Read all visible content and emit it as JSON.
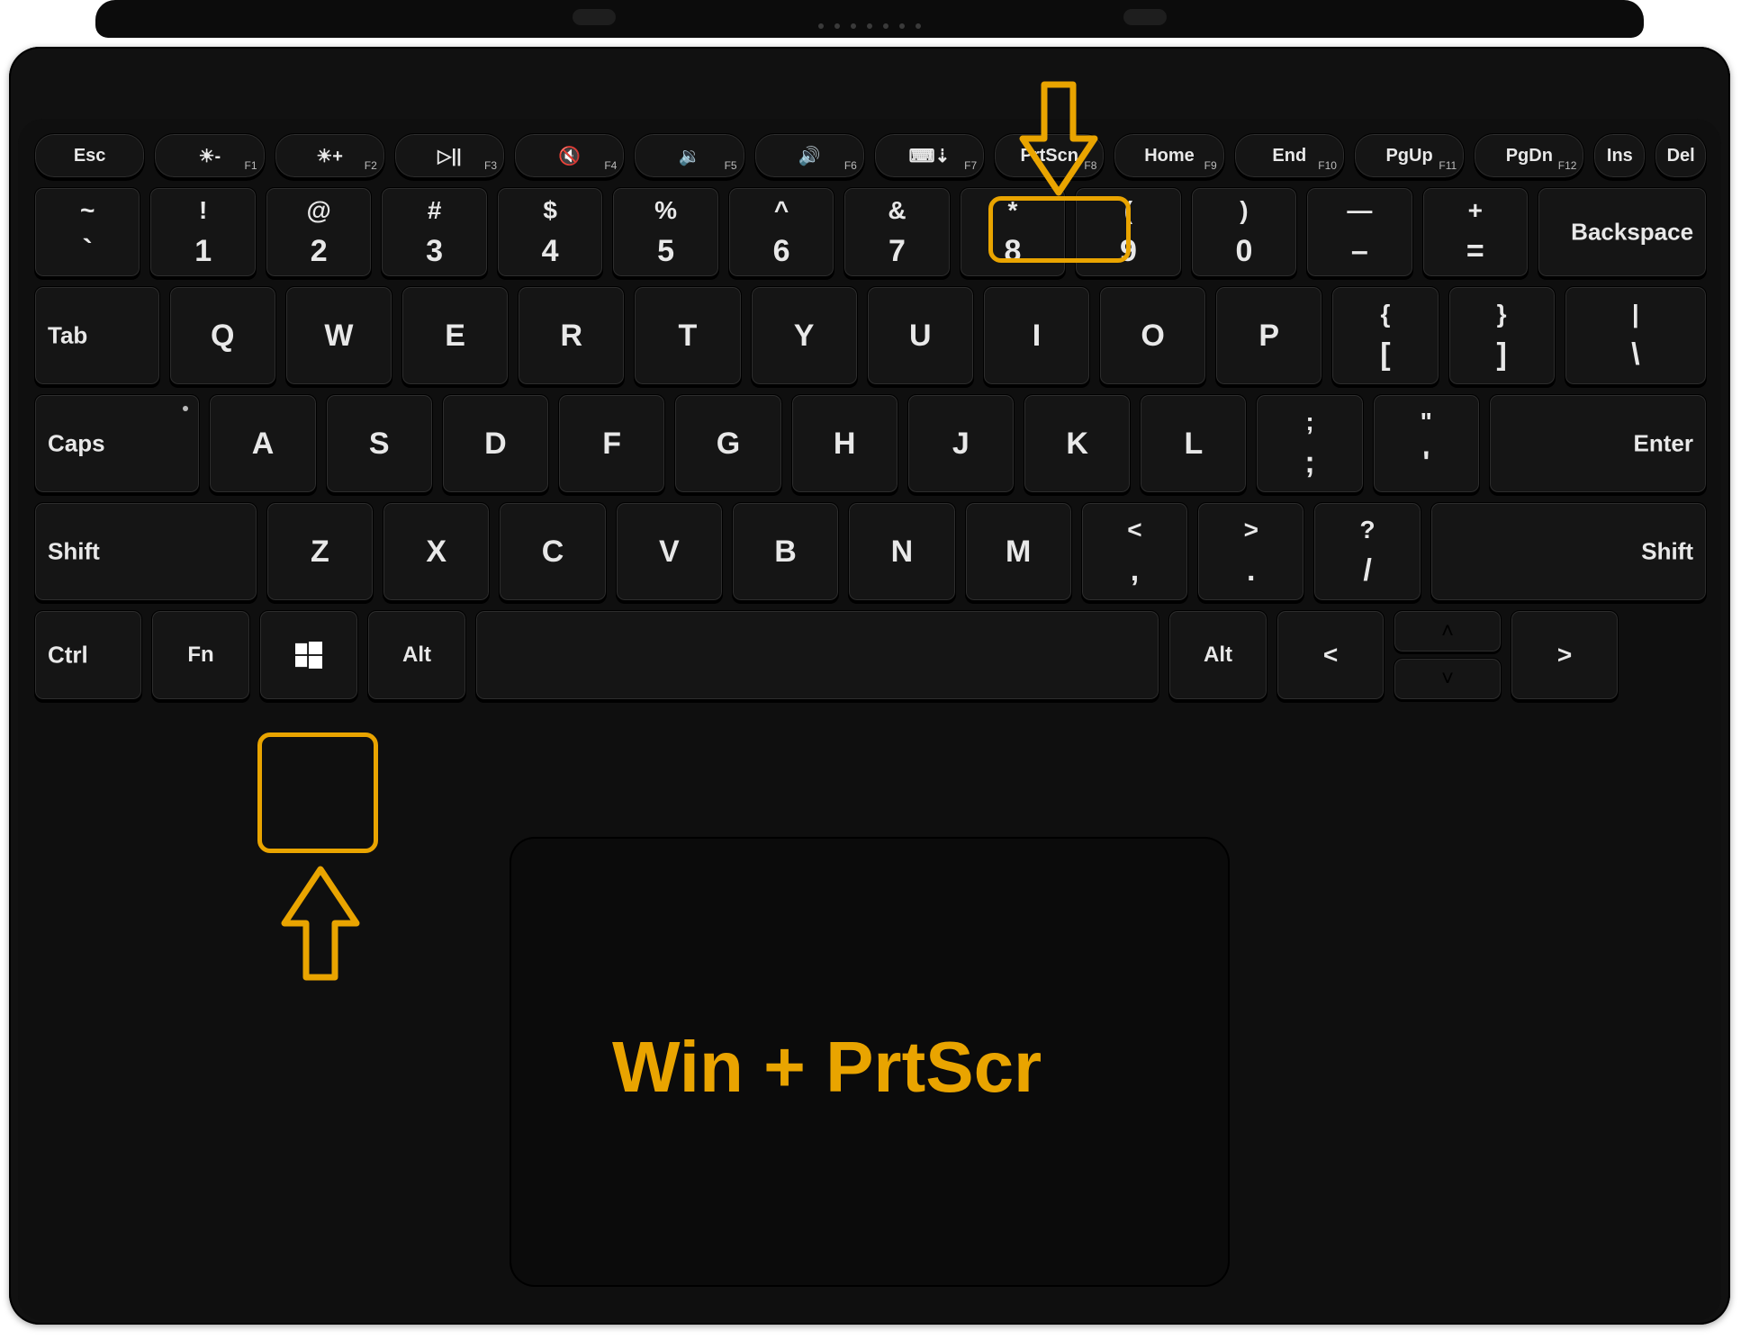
{
  "caption": "Win + PrtScr",
  "highlight_color": "#e9a400",
  "rows": {
    "fn": [
      {
        "label": "Esc",
        "sub": "",
        "name": "key-esc"
      },
      {
        "icon": "☀",
        "mod": "-",
        "sub": "F1",
        "name": "key-brightness-down"
      },
      {
        "icon": "☀",
        "mod": "+",
        "sub": "F2",
        "name": "key-brightness-up"
      },
      {
        "icon": "▷||",
        "sub": "F3",
        "name": "key-play-pause"
      },
      {
        "icon": "🔇",
        "sub": "F4",
        "name": "key-mute"
      },
      {
        "icon": "🔉",
        "sub": "F5",
        "name": "key-vol-down"
      },
      {
        "icon": "🔊",
        "sub": "F6",
        "name": "key-vol-up"
      },
      {
        "icon": "⌨⇣",
        "sub": "F7",
        "name": "key-kbd-backlight"
      },
      {
        "label": "PrtScn",
        "sub": "F8",
        "name": "key-prtscn"
      },
      {
        "label": "Home",
        "sub": "F9",
        "name": "key-home"
      },
      {
        "label": "End",
        "sub": "F10",
        "name": "key-end"
      },
      {
        "label": "PgUp",
        "sub": "F11",
        "name": "key-pgup"
      },
      {
        "label": "PgDn",
        "sub": "F12",
        "name": "key-pgdn"
      },
      {
        "label": "Ins",
        "sub": "",
        "name": "key-ins",
        "narrow": true
      },
      {
        "label": "Del",
        "sub": "",
        "name": "key-del",
        "narrow": true
      }
    ],
    "num": [
      {
        "top": "~",
        "bot": "`",
        "name": "key-backtick"
      },
      {
        "top": "!",
        "bot": "1",
        "name": "key-1"
      },
      {
        "top": "@",
        "bot": "2",
        "name": "key-2"
      },
      {
        "top": "#",
        "bot": "3",
        "name": "key-3"
      },
      {
        "top": "$",
        "bot": "4",
        "name": "key-4"
      },
      {
        "top": "%",
        "bot": "5",
        "name": "key-5"
      },
      {
        "top": "^",
        "bot": "6",
        "name": "key-6"
      },
      {
        "top": "&",
        "bot": "7",
        "name": "key-7"
      },
      {
        "top": "*",
        "bot": "8",
        "name": "key-8"
      },
      {
        "top": "(",
        "bot": "9",
        "name": "key-9"
      },
      {
        "top": ")",
        "bot": "0",
        "name": "key-0"
      },
      {
        "top": "—",
        "bot": "–",
        "name": "key-minus"
      },
      {
        "top": "+",
        "bot": "=",
        "name": "key-equals"
      },
      {
        "label": "Backspace",
        "wide": true,
        "name": "key-backspace"
      }
    ],
    "qw": [
      {
        "label": "Tab",
        "wideL": true,
        "name": "key-tab"
      },
      {
        "label": "Q",
        "name": "key-q"
      },
      {
        "label": "W",
        "name": "key-w"
      },
      {
        "label": "E",
        "name": "key-e"
      },
      {
        "label": "R",
        "name": "key-r"
      },
      {
        "label": "T",
        "name": "key-t"
      },
      {
        "label": "Y",
        "name": "key-y"
      },
      {
        "label": "U",
        "name": "key-u"
      },
      {
        "label": "I",
        "name": "key-i"
      },
      {
        "label": "O",
        "name": "key-o"
      },
      {
        "label": "P",
        "name": "key-p"
      },
      {
        "top": "{",
        "bot": "[",
        "name": "key-lbracket"
      },
      {
        "top": "}",
        "bot": "]",
        "name": "key-rbracket"
      },
      {
        "top": "|",
        "bot": "\\",
        "name": "key-backslash",
        "wideR": true
      }
    ],
    "as": [
      {
        "label": "Caps",
        "wideL": true,
        "name": "key-caps",
        "caps": true
      },
      {
        "label": "A",
        "name": "key-a"
      },
      {
        "label": "S",
        "name": "key-s"
      },
      {
        "label": "D",
        "name": "key-d"
      },
      {
        "label": "F",
        "name": "key-f"
      },
      {
        "label": "G",
        "name": "key-g"
      },
      {
        "label": "H",
        "name": "key-h"
      },
      {
        "label": "J",
        "name": "key-j"
      },
      {
        "label": "K",
        "name": "key-k"
      },
      {
        "label": "L",
        "name": "key-l"
      },
      {
        "top": ";",
        "bot": ";",
        "name": "key-semicolon"
      },
      {
        "top": "\"",
        "bot": "'",
        "name": "key-quote"
      },
      {
        "label": "Enter",
        "wideR": true,
        "name": "key-enter"
      }
    ],
    "zx": [
      {
        "label": "Shift",
        "wideL": true,
        "name": "key-lshift"
      },
      {
        "label": "Z",
        "name": "key-z"
      },
      {
        "label": "X",
        "name": "key-x"
      },
      {
        "label": "C",
        "name": "key-c"
      },
      {
        "label": "V",
        "name": "key-v"
      },
      {
        "label": "B",
        "name": "key-b"
      },
      {
        "label": "N",
        "name": "key-n"
      },
      {
        "label": "M",
        "name": "key-m"
      },
      {
        "top": "<",
        "bot": ",",
        "name": "key-comma"
      },
      {
        "top": ">",
        "bot": ".",
        "name": "key-period"
      },
      {
        "top": "?",
        "bot": "/",
        "name": "key-slash"
      },
      {
        "label": "Shift",
        "wideR": true,
        "name": "key-rshift"
      }
    ],
    "ctrl": {
      "ctrl": "Ctrl",
      "fn": "Fn",
      "win": "win",
      "alt": "Alt",
      "space": "",
      "altR": "Alt",
      "left": "<",
      "up": "˄",
      "down": "˅",
      "right": ">"
    }
  }
}
